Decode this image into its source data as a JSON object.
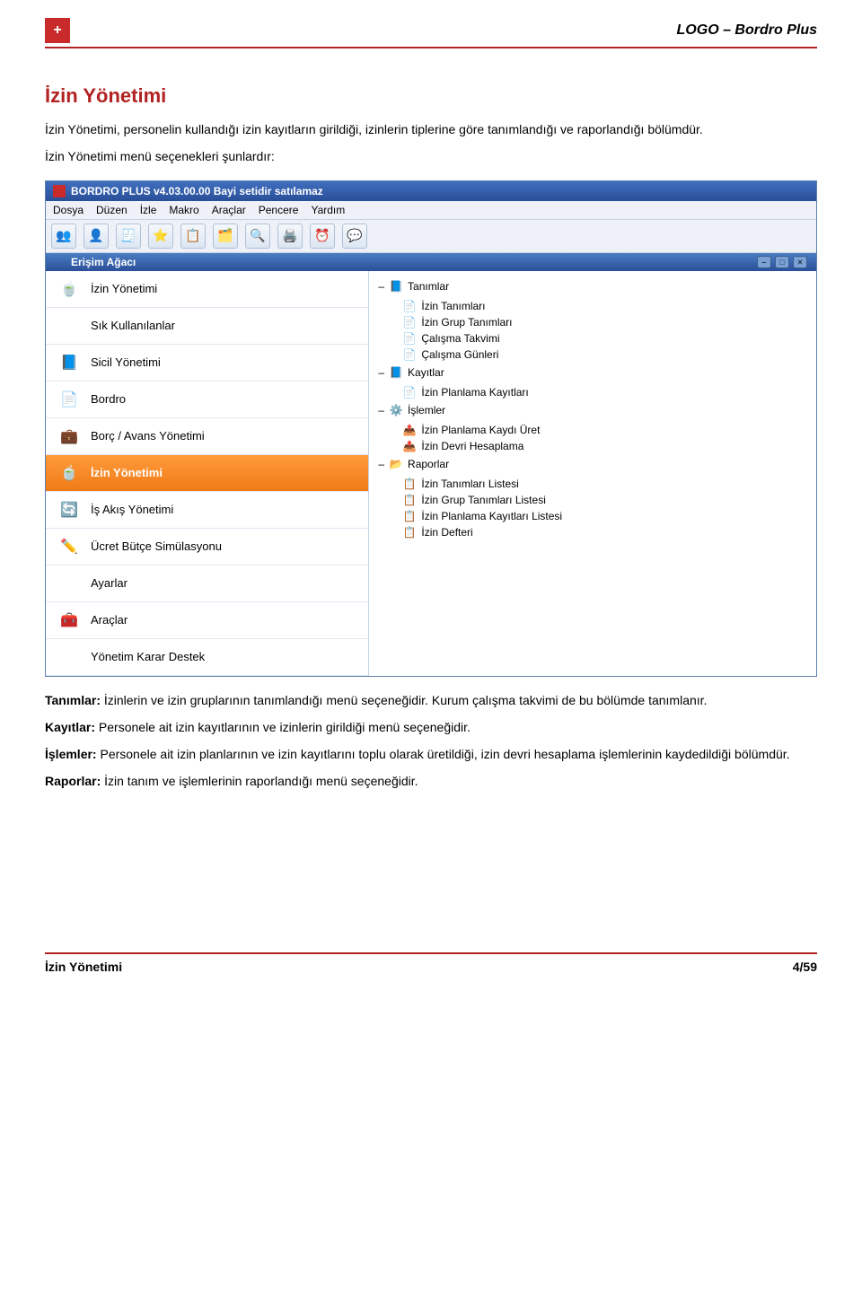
{
  "header": {
    "logo_symbol": "+",
    "product_name": "LOGO – Bordro Plus"
  },
  "section": {
    "title": "İzin Yönetimi",
    "intro": "İzin Yönetimi, personelin kullandığı izin kayıtların girildiği, izinlerin tiplerine göre tanımlandığı ve raporlandığı bölümdür.",
    "menu_lead": "İzin Yönetimi menü seçenekleri şunlardır:"
  },
  "app": {
    "titlebar": "BORDRO PLUS v4.03.00.00 Bayi setidir satılamaz",
    "menus": [
      "Dosya",
      "Düzen",
      "İzle",
      "Makro",
      "Araçlar",
      "Pencere",
      "Yardım"
    ],
    "toolbar_icons": [
      "👥",
      "👤",
      "🧾",
      "⭐",
      "📋",
      "🗂️",
      "🔍",
      "🖨️",
      "⏰",
      "💬"
    ],
    "sub_title": "Erişim Ağacı",
    "window_buttons": [
      "–",
      "□",
      "×"
    ]
  },
  "nav": {
    "items": [
      {
        "label": "İzin Yönetimi",
        "icon": "🍵"
      },
      {
        "label": "Sık Kullanılanlar",
        "icon": ""
      },
      {
        "label": "Sicil Yönetimi",
        "icon": "📘"
      },
      {
        "label": "Bordro",
        "icon": "📄"
      },
      {
        "label": "Borç / Avans Yönetimi",
        "icon": "💼"
      },
      {
        "label": "İzin Yönetimi",
        "icon": "🍵",
        "selected": true
      },
      {
        "label": "İş Akış Yönetimi",
        "icon": "🔄"
      },
      {
        "label": "Ücret Bütçe Simülasyonu",
        "icon": "✏️"
      },
      {
        "label": "Ayarlar",
        "icon": ""
      },
      {
        "label": "Araçlar",
        "icon": "🧰"
      },
      {
        "label": "Yönetim Karar Destek",
        "icon": ""
      }
    ]
  },
  "tree": {
    "nodes": [
      {
        "label": "Tanımlar",
        "icon": "📘",
        "children": [
          {
            "label": "İzin Tanımları",
            "icon": "📄"
          },
          {
            "label": "İzin Grup Tanımları",
            "icon": "📄"
          },
          {
            "label": "Çalışma Takvimi",
            "icon": "📄"
          },
          {
            "label": "Çalışma Günleri",
            "icon": "📄"
          }
        ]
      },
      {
        "label": "Kayıtlar",
        "icon": "📘",
        "children": [
          {
            "label": "İzin Planlama Kayıtları",
            "icon": "📄"
          }
        ]
      },
      {
        "label": "İşlemler",
        "icon": "⚙️",
        "children": [
          {
            "label": "İzin Planlama Kaydı Üret",
            "icon": "📤"
          },
          {
            "label": "İzin Devri Hesaplama",
            "icon": "📤"
          }
        ]
      },
      {
        "label": "Raporlar",
        "icon": "📂",
        "selected": true,
        "children": [
          {
            "label": "İzin Tanımları Listesi",
            "icon": "📋"
          },
          {
            "label": "İzin Grup Tanımları Listesi",
            "icon": "📋"
          },
          {
            "label": "İzin Planlama Kayıtları Listesi",
            "icon": "📋"
          },
          {
            "label": "İzin Defteri",
            "icon": "📋"
          }
        ]
      }
    ]
  },
  "definitions": {
    "tanimlar_label": "Tanımlar:",
    "tanimlar_text": " İzinlerin ve izin gruplarının tanımlandığı menü seçeneğidir. Kurum çalışma takvimi de bu bölümde tanımlanır.",
    "kayitlar_label": "Kayıtlar:",
    "kayitlar_text": " Personele ait izin kayıtlarının ve izinlerin girildiği menü seçeneğidir.",
    "islemler_label": "İşlemler:",
    "islemler_text": " Personele ait izin planlarının ve izin kayıtlarını toplu olarak üretildiği, izin devri hesaplama işlemlerinin kaydedildiği bölümdür.",
    "raporlar_label": "Raporlar:",
    "raporlar_text": " İzin tanım ve işlemlerinin raporlandığı menü seçeneğidir."
  },
  "footer": {
    "left": "İzin Yönetimi",
    "right": "4/59"
  }
}
